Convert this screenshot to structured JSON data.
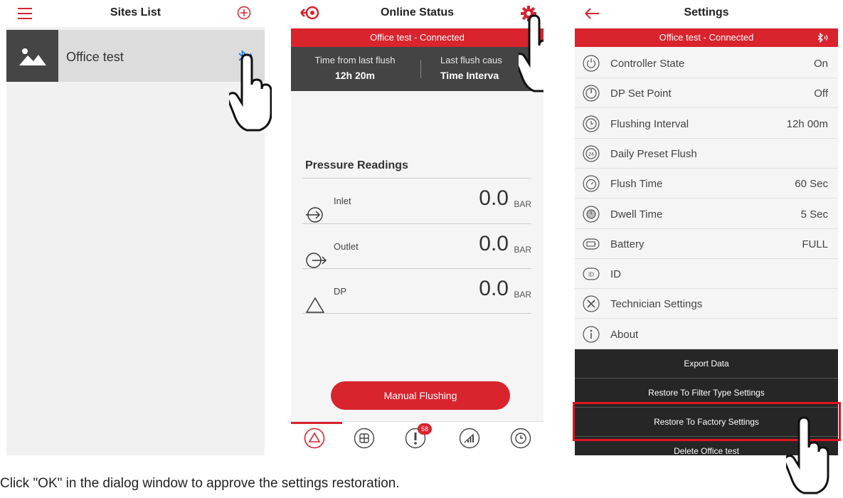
{
  "sites_list": {
    "title": "Sites List",
    "menu_icon": "hamburger-menu-icon",
    "add_icon": "add-circle-icon",
    "site_name": "Office test",
    "site_icon": "image-placeholder-icon",
    "status_icon": "bluetooth-connected-icon"
  },
  "online_status": {
    "title": "Online Status",
    "connection": "Office test - Connected",
    "last_flush_label": "Time from last flush",
    "last_flush_value": "12h 20m",
    "cause_label": "Last flush caus",
    "cause_value": "Time Interva",
    "section_title": "Pressure Readings",
    "readings": [
      {
        "label": "Inlet",
        "value": "0.0",
        "unit": "BAR",
        "icon": "inlet-arrow-icon"
      },
      {
        "label": "Outlet",
        "value": "0.0",
        "unit": "BAR",
        "icon": "outlet-arrow-icon"
      },
      {
        "label": "DP",
        "value": "0.0",
        "unit": "BAR",
        "icon": "delta-triangle-icon"
      }
    ],
    "flush_button": "Manual Flushing",
    "alert_count": "58",
    "tabs": [
      "status-triangle-icon",
      "dashboard-grid-icon",
      "alerts-icon",
      "signal-chart-icon",
      "history-clock-icon"
    ]
  },
  "settings": {
    "title": "Settings",
    "connection": "Office test - Connected",
    "items": [
      {
        "label": "Controller State",
        "value": "On",
        "icon": "power-icon"
      },
      {
        "label": "DP Set Point",
        "value": "Off",
        "icon": "gauge-icon"
      },
      {
        "label": "Flushing Interval",
        "value": "12h 00m",
        "icon": "clock-icon"
      },
      {
        "label": "Daily Preset Flush",
        "value": "",
        "icon": "24h-icon"
      },
      {
        "label": "Flush Time",
        "value": "60 Sec",
        "icon": "timer-icon"
      },
      {
        "label": "Dwell Time",
        "value": "5 Sec",
        "icon": "stopwatch-icon"
      },
      {
        "label": "Battery",
        "value": "FULL",
        "icon": "battery-icon"
      },
      {
        "label": "ID",
        "value": "",
        "icon": "id-icon"
      },
      {
        "label": "Technician Settings",
        "value": "",
        "icon": "tools-icon"
      },
      {
        "label": "About",
        "value": "",
        "icon": "info-icon"
      }
    ],
    "actions": [
      "Export Data",
      "Restore To Filter Type Settings",
      "Restore To Factory Settings",
      "Delete Office test"
    ]
  },
  "caption": "Click \"OK\" in the dialog window to approve the settings restoration.",
  "colors": {
    "brand_red": "#d9232d",
    "highlight_red": "#e0151f",
    "dark": "#262626"
  }
}
